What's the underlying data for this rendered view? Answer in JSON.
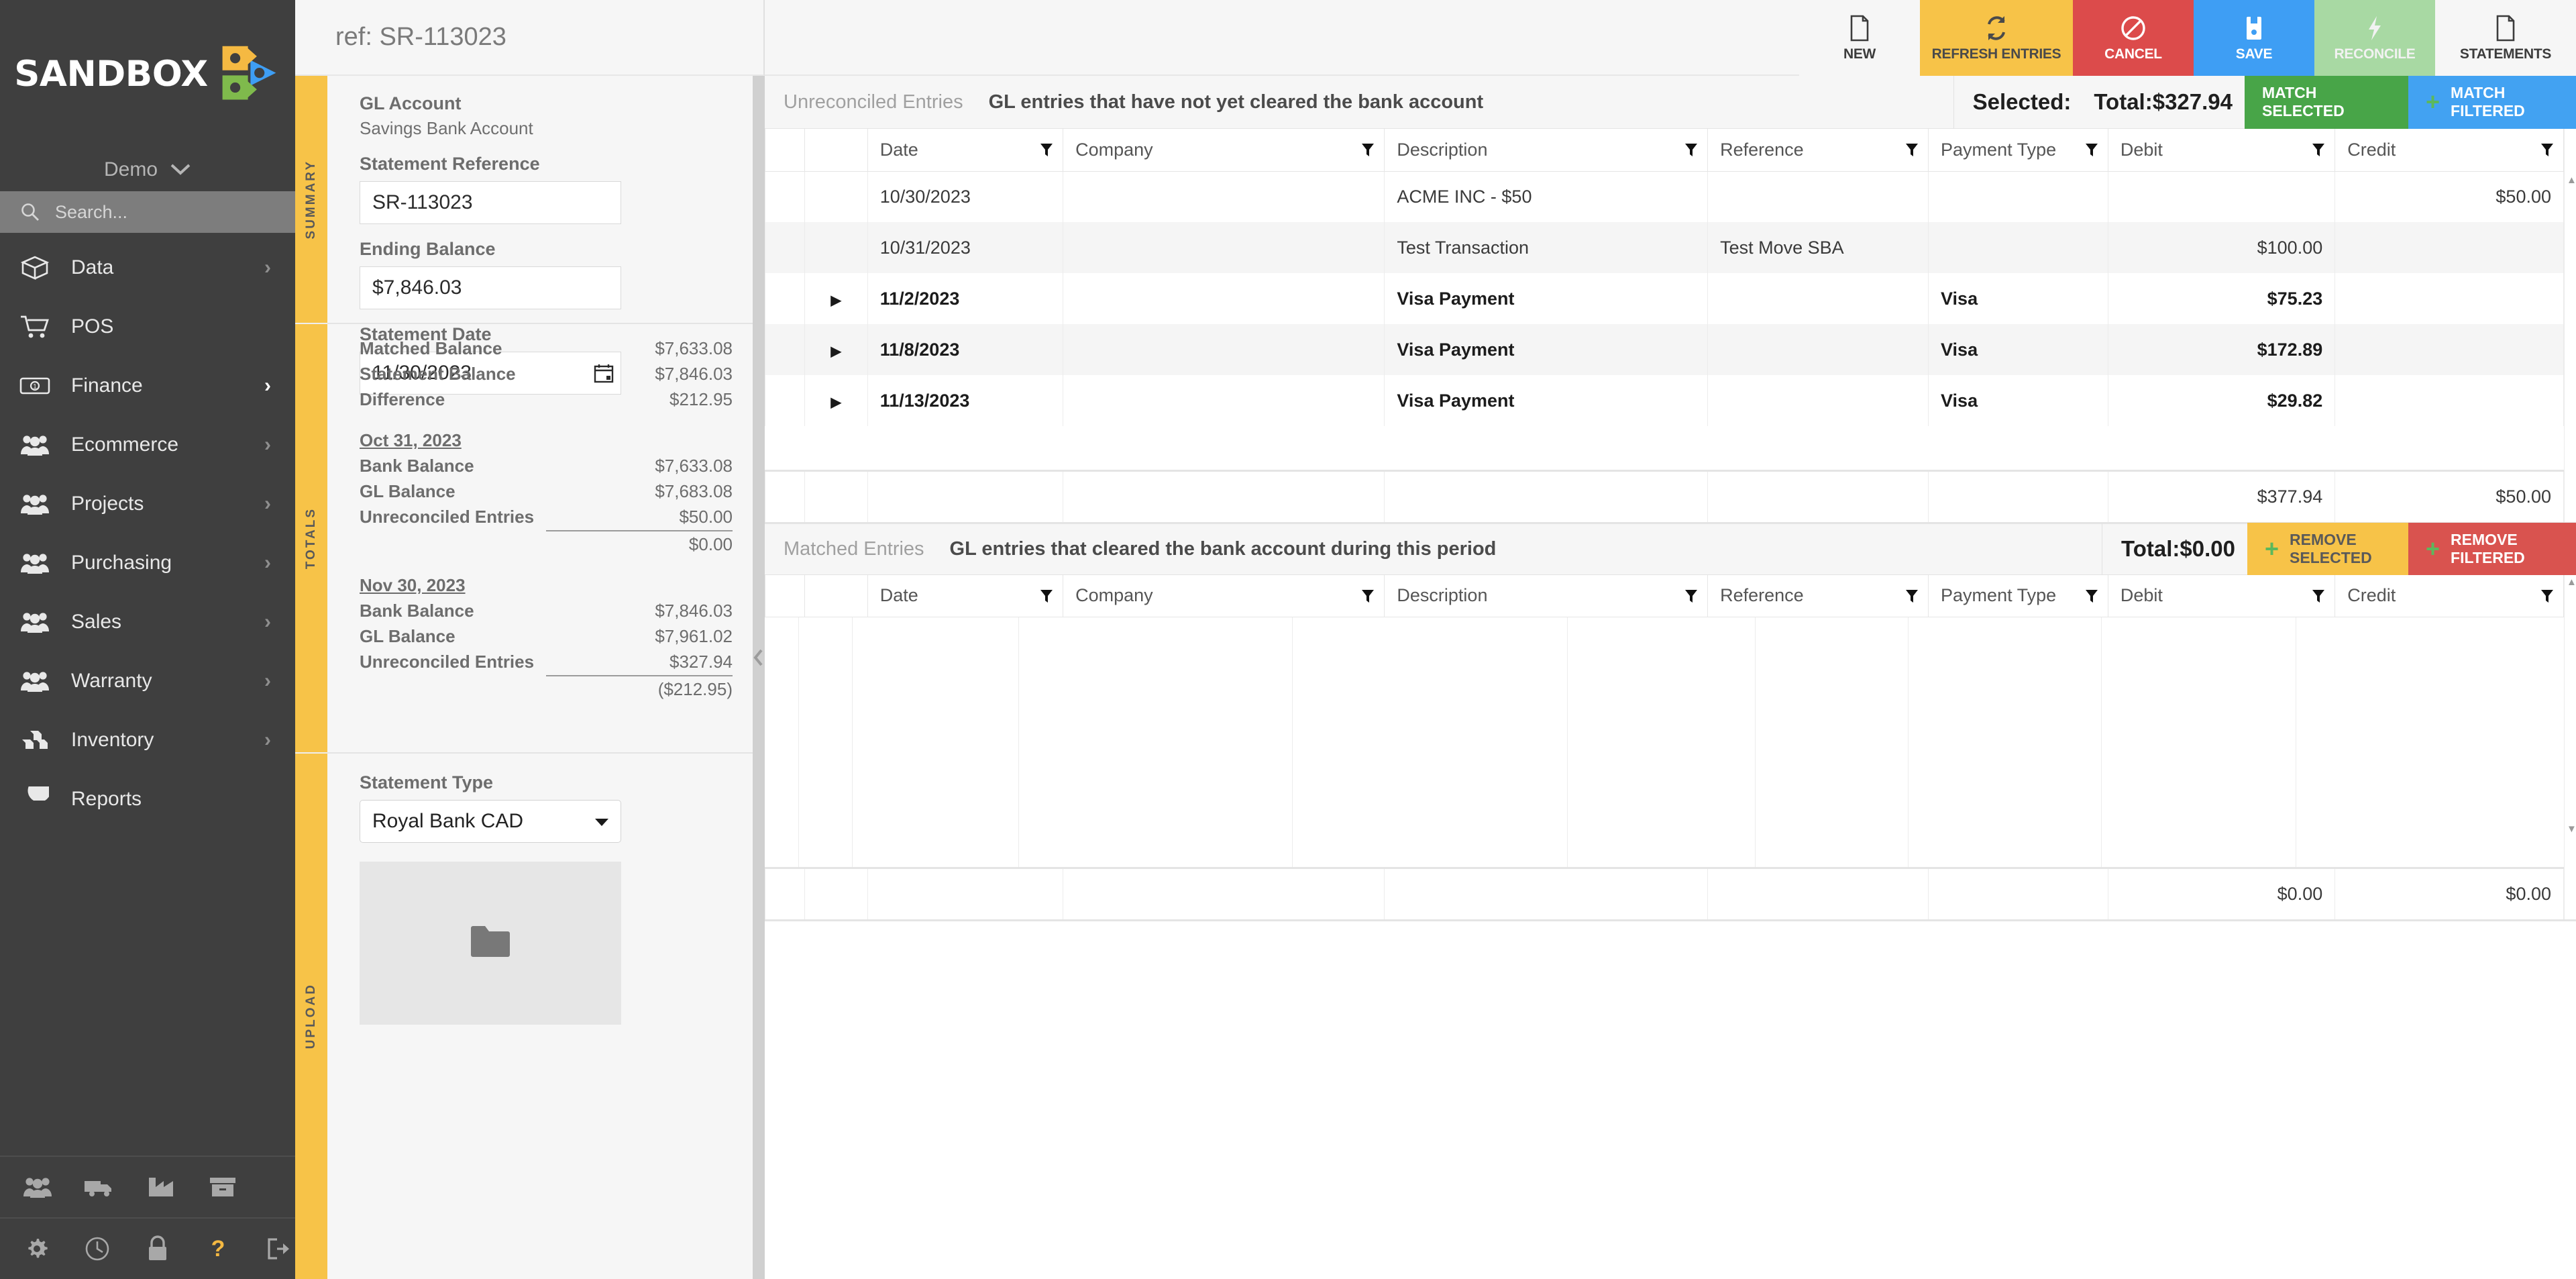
{
  "brand": {
    "name": "SANDBOX",
    "tenant": "Demo"
  },
  "search": {
    "placeholder": "Search..."
  },
  "sidebar": {
    "items": [
      {
        "label": "Data",
        "icon": "box-icon",
        "has_caret": true,
        "active": false
      },
      {
        "label": "POS",
        "icon": "cart-icon",
        "has_caret": false,
        "active": false
      },
      {
        "label": "Finance",
        "icon": "banknote-icon",
        "has_caret": true,
        "active": true
      },
      {
        "label": "Ecommerce",
        "icon": "people-icon",
        "has_caret": true,
        "active": false
      },
      {
        "label": "Projects",
        "icon": "people-icon",
        "has_caret": true,
        "active": false
      },
      {
        "label": "Purchasing",
        "icon": "people-icon",
        "has_caret": true,
        "active": false
      },
      {
        "label": "Sales",
        "icon": "people-icon",
        "has_caret": true,
        "active": false
      },
      {
        "label": "Warranty",
        "icon": "people-icon",
        "has_caret": true,
        "active": false
      },
      {
        "label": "Inventory",
        "icon": "boxes-icon",
        "has_caret": true,
        "active": false
      },
      {
        "label": "Reports",
        "icon": "pie-chart-icon",
        "has_caret": false,
        "active": false
      }
    ],
    "bottom_row_1": [
      "people-icon",
      "truck-icon",
      "factory-icon",
      "archive-icon"
    ],
    "bottom_row_2": [
      "gear-icon",
      "clock-icon",
      "lock-icon",
      "question-icon",
      "logout-icon"
    ]
  },
  "header": {
    "ref_label": "ref: SR-113023"
  },
  "toolbar": {
    "buttons": [
      {
        "label": "NEW",
        "icon": "file-icon",
        "style": "new"
      },
      {
        "label": "REFRESH ENTRIES",
        "icon": "refresh-icon",
        "style": "refresh"
      },
      {
        "label": "CANCEL",
        "icon": "ban-icon",
        "style": "cancel"
      },
      {
        "label": "SAVE",
        "icon": "save-icon",
        "style": "save"
      },
      {
        "label": "RECONCILE",
        "icon": "bolt-icon",
        "style": "reconcile"
      },
      {
        "label": "STATEMENTS",
        "icon": "file-icon",
        "style": "statements"
      }
    ]
  },
  "left_panel": {
    "tabs": {
      "summary": "SUMMARY",
      "totals": "TOTALS",
      "upload": "UPLOAD"
    },
    "summary": {
      "gl_account_label": "GL Account",
      "gl_account_value": "Savings Bank Account",
      "statement_reference_label": "Statement Reference",
      "statement_reference_value": "SR-113023",
      "ending_balance_label": "Ending Balance",
      "ending_balance_value": "$7,846.03",
      "statement_date_label": "Statement Date",
      "statement_date_value": "11/30/2023",
      "calendar_icon": "calendar-icon"
    },
    "totals": {
      "matched_balance_label": "Matched Balance",
      "matched_balance_value": "$7,633.08",
      "statement_balance_label": "Statement Balance",
      "statement_balance_value": "$7,846.03",
      "difference_label": "Difference",
      "difference_value": "$212.95",
      "period_1": {
        "date": "Oct 31, 2023",
        "bank_balance_label": "Bank Balance",
        "bank_balance_value": "$7,633.08",
        "gl_balance_label": "GL Balance",
        "gl_balance_value": "$7,683.08",
        "unreconciled_label": "Unreconciled Entries",
        "unreconciled_value": "$50.00",
        "net_value": "$0.00"
      },
      "period_2": {
        "date": "Nov 30, 2023",
        "bank_balance_label": "Bank Balance",
        "bank_balance_value": "$7,846.03",
        "gl_balance_label": "GL Balance",
        "gl_balance_value": "$7,961.02",
        "unreconciled_label": "Unreconciled Entries",
        "unreconciled_value": "$327.94",
        "net_value": "($212.95)"
      }
    },
    "upload": {
      "statement_type_label": "Statement Type",
      "statement_type_value": "Royal Bank CAD",
      "dropzone_icon": "folder-icon"
    },
    "collapse_icon": "chevron-left-icon"
  },
  "unreconciled": {
    "title": "Unreconciled Entries",
    "description": "GL entries that have not yet cleared the bank account",
    "selected_label": "Selected:",
    "total_label": "Total:$327.94",
    "match_selected_label": "MATCH SELECTED",
    "match_filtered_label": "MATCH FILTERED",
    "columns": [
      "Date",
      "Company",
      "Description",
      "Reference",
      "Payment Type",
      "Debit",
      "Credit"
    ],
    "rows": [
      {
        "expand": false,
        "date": "10/30/2023",
        "company": "",
        "description": "ACME INC - $50",
        "reference": "",
        "payment_type": "",
        "debit": "",
        "credit": "$50.00",
        "bold": false
      },
      {
        "expand": false,
        "date": "10/31/2023",
        "company": "",
        "description": "Test Transaction",
        "reference": "Test Move SBA",
        "payment_type": "",
        "debit": "$100.00",
        "credit": "",
        "bold": false
      },
      {
        "expand": true,
        "date": "11/2/2023",
        "company": "",
        "description": "Visa Payment",
        "reference": "",
        "payment_type": "Visa",
        "debit": "$75.23",
        "credit": "",
        "bold": true
      },
      {
        "expand": true,
        "date": "11/8/2023",
        "company": "",
        "description": "Visa Payment",
        "reference": "",
        "payment_type": "Visa",
        "debit": "$172.89",
        "credit": "",
        "bold": true
      },
      {
        "expand": true,
        "date": "11/13/2023",
        "company": "",
        "description": "Visa Payment",
        "reference": "",
        "payment_type": "Visa",
        "debit": "$29.82",
        "credit": "",
        "bold": true
      }
    ],
    "footer": {
      "debit_total": "$377.94",
      "credit_total": "$50.00"
    }
  },
  "matched": {
    "title": "Matched Entries",
    "description": "GL entries that cleared the bank account during this period",
    "total_label": "Total:$0.00",
    "remove_selected_label": "REMOVE SELECTED",
    "remove_filtered_label": "REMOVE FILTERED",
    "columns": [
      "Date",
      "Company",
      "Description",
      "Reference",
      "Payment Type",
      "Debit",
      "Credit"
    ],
    "rows": [],
    "footer": {
      "debit_total": "$0.00",
      "credit_total": "$0.00"
    }
  },
  "colors": {
    "sidebar_bg": "#3f3f3f",
    "accent_yellow": "#f7c348",
    "danger_red": "#dc4b4b",
    "primary_blue": "#3e9ef4",
    "success_green": "#48a548",
    "muted_green": "#a8d9a3"
  }
}
